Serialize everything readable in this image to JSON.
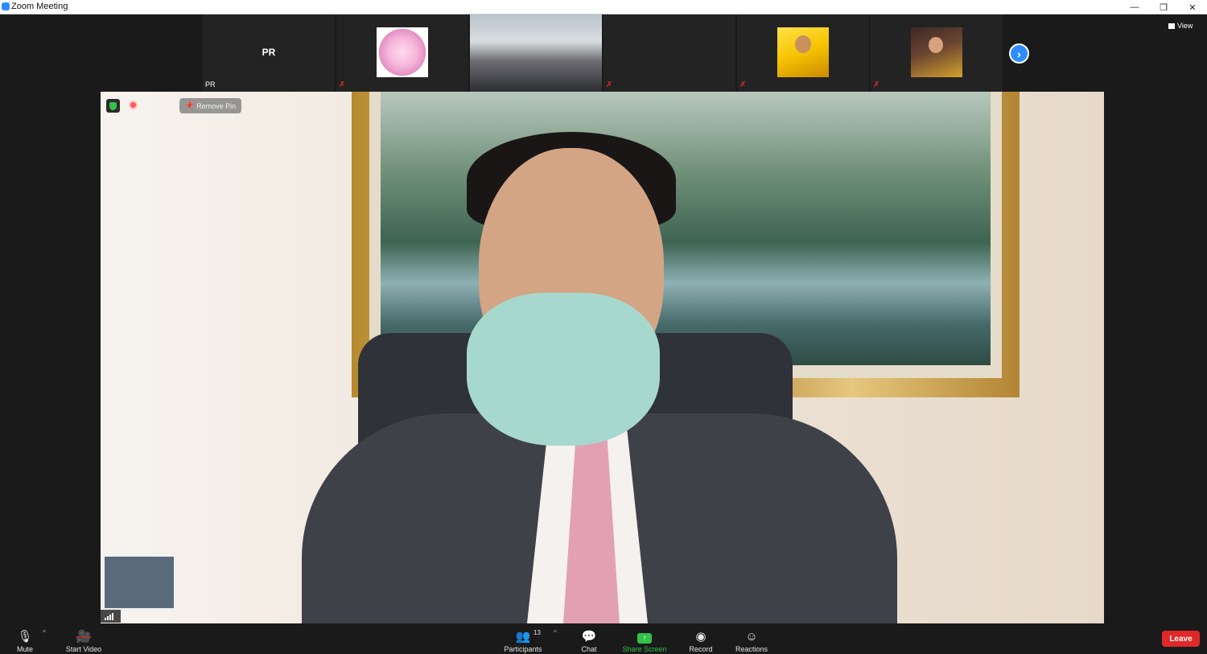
{
  "window": {
    "title": "Zoom Meeting",
    "minimize": "—",
    "maximize": "❐",
    "close": "✕"
  },
  "gallery": {
    "tiles": [
      {
        "big_name": "PR",
        "label": "PR",
        "muted": false,
        "thumb": ""
      },
      {
        "big_name": "",
        "label": "",
        "muted": true,
        "thumb": "seal"
      },
      {
        "big_name": "",
        "label": "",
        "muted": false,
        "thumb": "room"
      },
      {
        "big_name": "",
        "label": "",
        "muted": true,
        "thumb": ""
      },
      {
        "big_name": "",
        "label": "",
        "muted": true,
        "thumb": "yellow"
      },
      {
        "big_name": "",
        "label": "",
        "muted": true,
        "thumb": "woman"
      }
    ],
    "next_icon": "chevron-right-icon",
    "view_label": "View"
  },
  "main": {
    "remove_pin_label": "Remove Pin",
    "speaker_name": ""
  },
  "toolbar": {
    "mute_label": "Mute",
    "start_video_label": "Start Video",
    "participants_label": "Participants",
    "participants_count": "13",
    "chat_label": "Chat",
    "share_label": "Share Screen",
    "record_label": "Record",
    "reactions_label": "Reactions",
    "leave_label": "Leave"
  },
  "colors": {
    "accent": "#2d8cff",
    "leave": "#e02828",
    "share": "#31c248"
  }
}
